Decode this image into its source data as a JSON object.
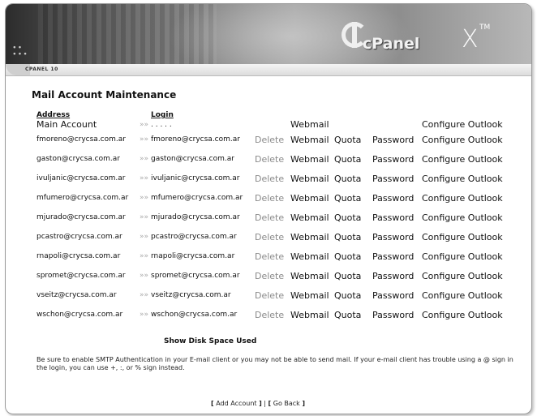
{
  "header": {
    "brand": "cPanel",
    "version_mark": "X",
    "tm": "TM",
    "breadcrumb": "CPANEL 10"
  },
  "page_title": "Mail Account Maintenance",
  "columns": {
    "address": "Address",
    "login": "Login"
  },
  "separator": "»»",
  "main_account": {
    "address": "Main Account",
    "login": ".  .  .  .  .",
    "webmail": "Webmail",
    "configure": "Configure Outlook"
  },
  "actions": {
    "delete": "Delete",
    "webmail": "Webmail",
    "quota": "Quota",
    "password": "Password",
    "configure": "Configure Outlook"
  },
  "accounts": [
    {
      "address": "fmoreno@crycsa.com.ar",
      "login": "fmoreno@crycsa.com.ar"
    },
    {
      "address": "gaston@crycsa.com.ar",
      "login": "gaston@crycsa.com.ar"
    },
    {
      "address": "ivuljanic@crycsa.com.ar",
      "login": "ivuljanic@crycsa.com.ar"
    },
    {
      "address": "mfumero@crycsa.com.ar",
      "login": "mfumero@crycsa.com.ar"
    },
    {
      "address": "mjurado@crycsa.com.ar",
      "login": "mjurado@crycsa.com.ar"
    },
    {
      "address": "pcastro@crycsa.com.ar",
      "login": "pcastro@crycsa.com.ar"
    },
    {
      "address": "rnapoli@crycsa.com.ar",
      "login": "rnapoli@crycsa.com.ar"
    },
    {
      "address": "spromet@crycsa.com.ar",
      "login": "spromet@crycsa.com.ar"
    },
    {
      "address": "vseitz@crycsa.com.ar",
      "login": "vseitz@crycsa.com.ar"
    },
    {
      "address": "wschon@crycsa.com.ar",
      "login": "wschon@crycsa.com.ar"
    }
  ],
  "show_disk_space": "Show Disk Space Used",
  "notice": "Be sure to enable SMTP Authentication in your E-mail client or you may not be able to send mail. If your e-mail client has trouble using a @ sign in the login, you can use +, :, or % sign instead.",
  "footer": {
    "add_account": "Add Account",
    "go_back": "Go Back",
    "divider": "|"
  }
}
